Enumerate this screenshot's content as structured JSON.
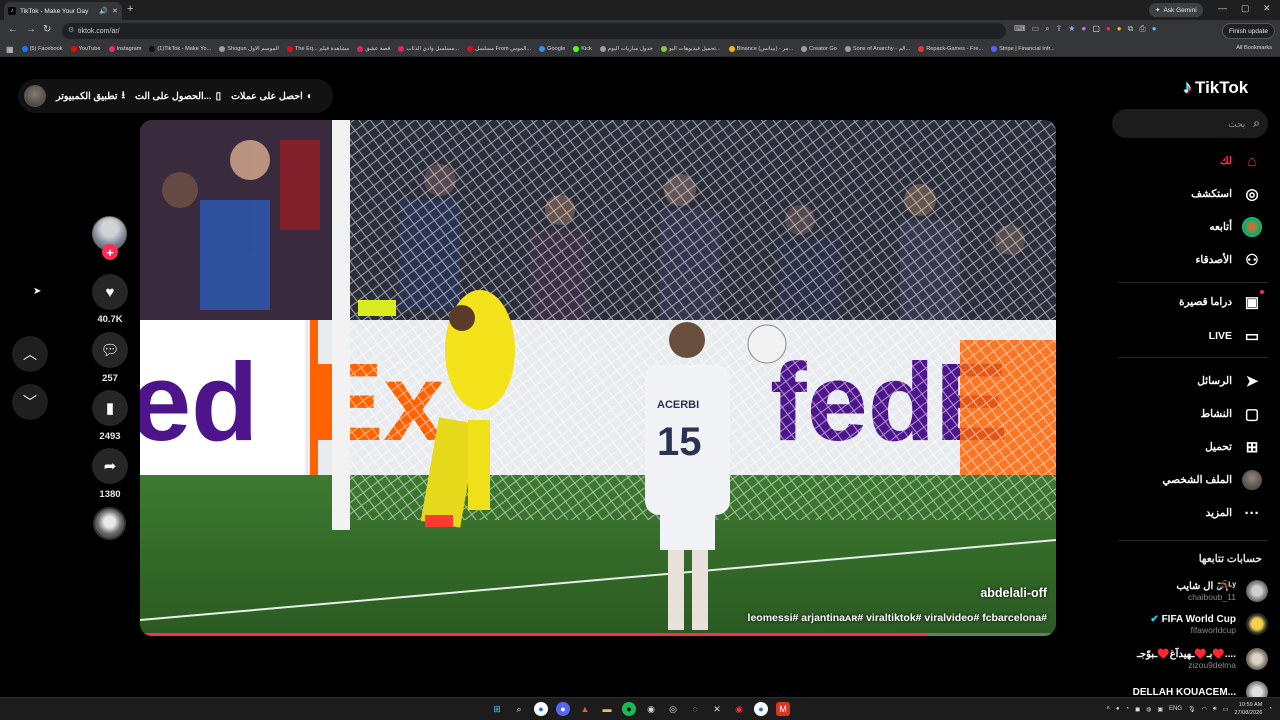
{
  "browser": {
    "tab_title": "TikTok - Make Your Day",
    "new_tab": "+",
    "ask_gemini": "Ask Gemini",
    "url": "tiktok.com/ar/",
    "finish_update": "Finish update",
    "all_bookmarks": "All Bookmarks",
    "bookmarks": [
      {
        "label": "(5) Facebook",
        "color": "#1877f2"
      },
      {
        "label": "YouTube",
        "color": "#ff0000"
      },
      {
        "label": "Instagram",
        "color": "#e1306c"
      },
      {
        "label": "(1)TikTok - Make Yo...",
        "color": "#111111"
      },
      {
        "label": "Shogun الموسم الاول",
        "color": "#9aa0a6"
      },
      {
        "label": "The Eq... مشاهدة فيلم",
        "color": "#e50914"
      },
      {
        "label": "قصة عشق",
        "color": "#e91e63"
      },
      {
        "label": "مسلسل وادي الذئاب...",
        "color": "#e91e63"
      },
      {
        "label": "مسلسل From الموس...",
        "color": "#e50914"
      },
      {
        "label": "Google",
        "color": "#4285f4"
      },
      {
        "label": "Kick",
        "color": "#53fc18"
      },
      {
        "label": "جدول مباريات اليوم",
        "color": "#9aa0a6"
      },
      {
        "label": "تحميل فيديوهات اليو...",
        "color": "#8bc34a"
      },
      {
        "label": "Binance (بينانس) - مر...",
        "color": "#f0b90b"
      },
      {
        "label": "Creator Go",
        "color": "#9aa0a6"
      },
      {
        "label": "Sons of Anarchy - الم...",
        "color": "#9aa0a6"
      },
      {
        "label": "Repack-Games - Fre...",
        "color": "#e53935"
      },
      {
        "label": "Stripe | Financial Infr...",
        "color": "#635bff"
      }
    ]
  },
  "header": {
    "get_coins": "احصل على عملات",
    "get_app": "الحصول على الت...",
    "desktop_app": "تطبيق الكمبيوتر"
  },
  "actions": {
    "likes": "40.7K",
    "comments": "257",
    "saves": "2493",
    "shares": "1380"
  },
  "video": {
    "author": "abdelali-off",
    "hashtags": "leomessi# arjantinaᴀʀ# viraltiktok# viralvideo# fcbarcelona#",
    "progress": 0.86,
    "jersey_name": "ACERBI",
    "jersey_number": "15"
  },
  "sidebar": {
    "logo": "TikTok",
    "search_placeholder": "بحث",
    "nav": [
      {
        "label": "لك",
        "icon": "home-icon",
        "glyph": "⌂"
      },
      {
        "label": "استكشف",
        "icon": "compass-icon",
        "glyph": "◎"
      },
      {
        "label": "أتابعه",
        "icon": "following-avatar-icon",
        "glyph": ""
      },
      {
        "label": "الأصدقاء",
        "icon": "friends-icon",
        "glyph": "⚇"
      },
      {
        "label": "دراما قصيرة",
        "icon": "short-drama-icon",
        "glyph": "▣"
      },
      {
        "label": "LIVE",
        "icon": "live-icon",
        "glyph": "▭"
      },
      {
        "label": "الرسائل",
        "icon": "messages-icon",
        "glyph": "➤"
      },
      {
        "label": "النشاط",
        "icon": "activity-icon",
        "glyph": "▢"
      },
      {
        "label": "تحميل",
        "icon": "upload-icon",
        "glyph": "⊞"
      },
      {
        "label": "الملف الشخصي",
        "icon": "profile-avatar-icon",
        "glyph": ""
      },
      {
        "label": "المزيد",
        "icon": "more-icon",
        "glyph": "···"
      }
    ],
    "following_title": "حسابات تتابعها",
    "accounts": [
      {
        "name": "ال شايب 🪃ᴸʸ",
        "username": "chaiboub_11"
      },
      {
        "name": "FIFA World Cup",
        "username": "fifaworldcup"
      },
      {
        "name": "بـ♥️ـهيدآغ♥️ـبوّجـ♥️....",
        "username": "zizou9delma"
      },
      {
        "name": "DELLAH KOUACEM...",
        "username": ""
      }
    ]
  },
  "taskbar": {
    "lang": "ENG",
    "time": "10:59 AM",
    "date": "27/08/2026"
  }
}
